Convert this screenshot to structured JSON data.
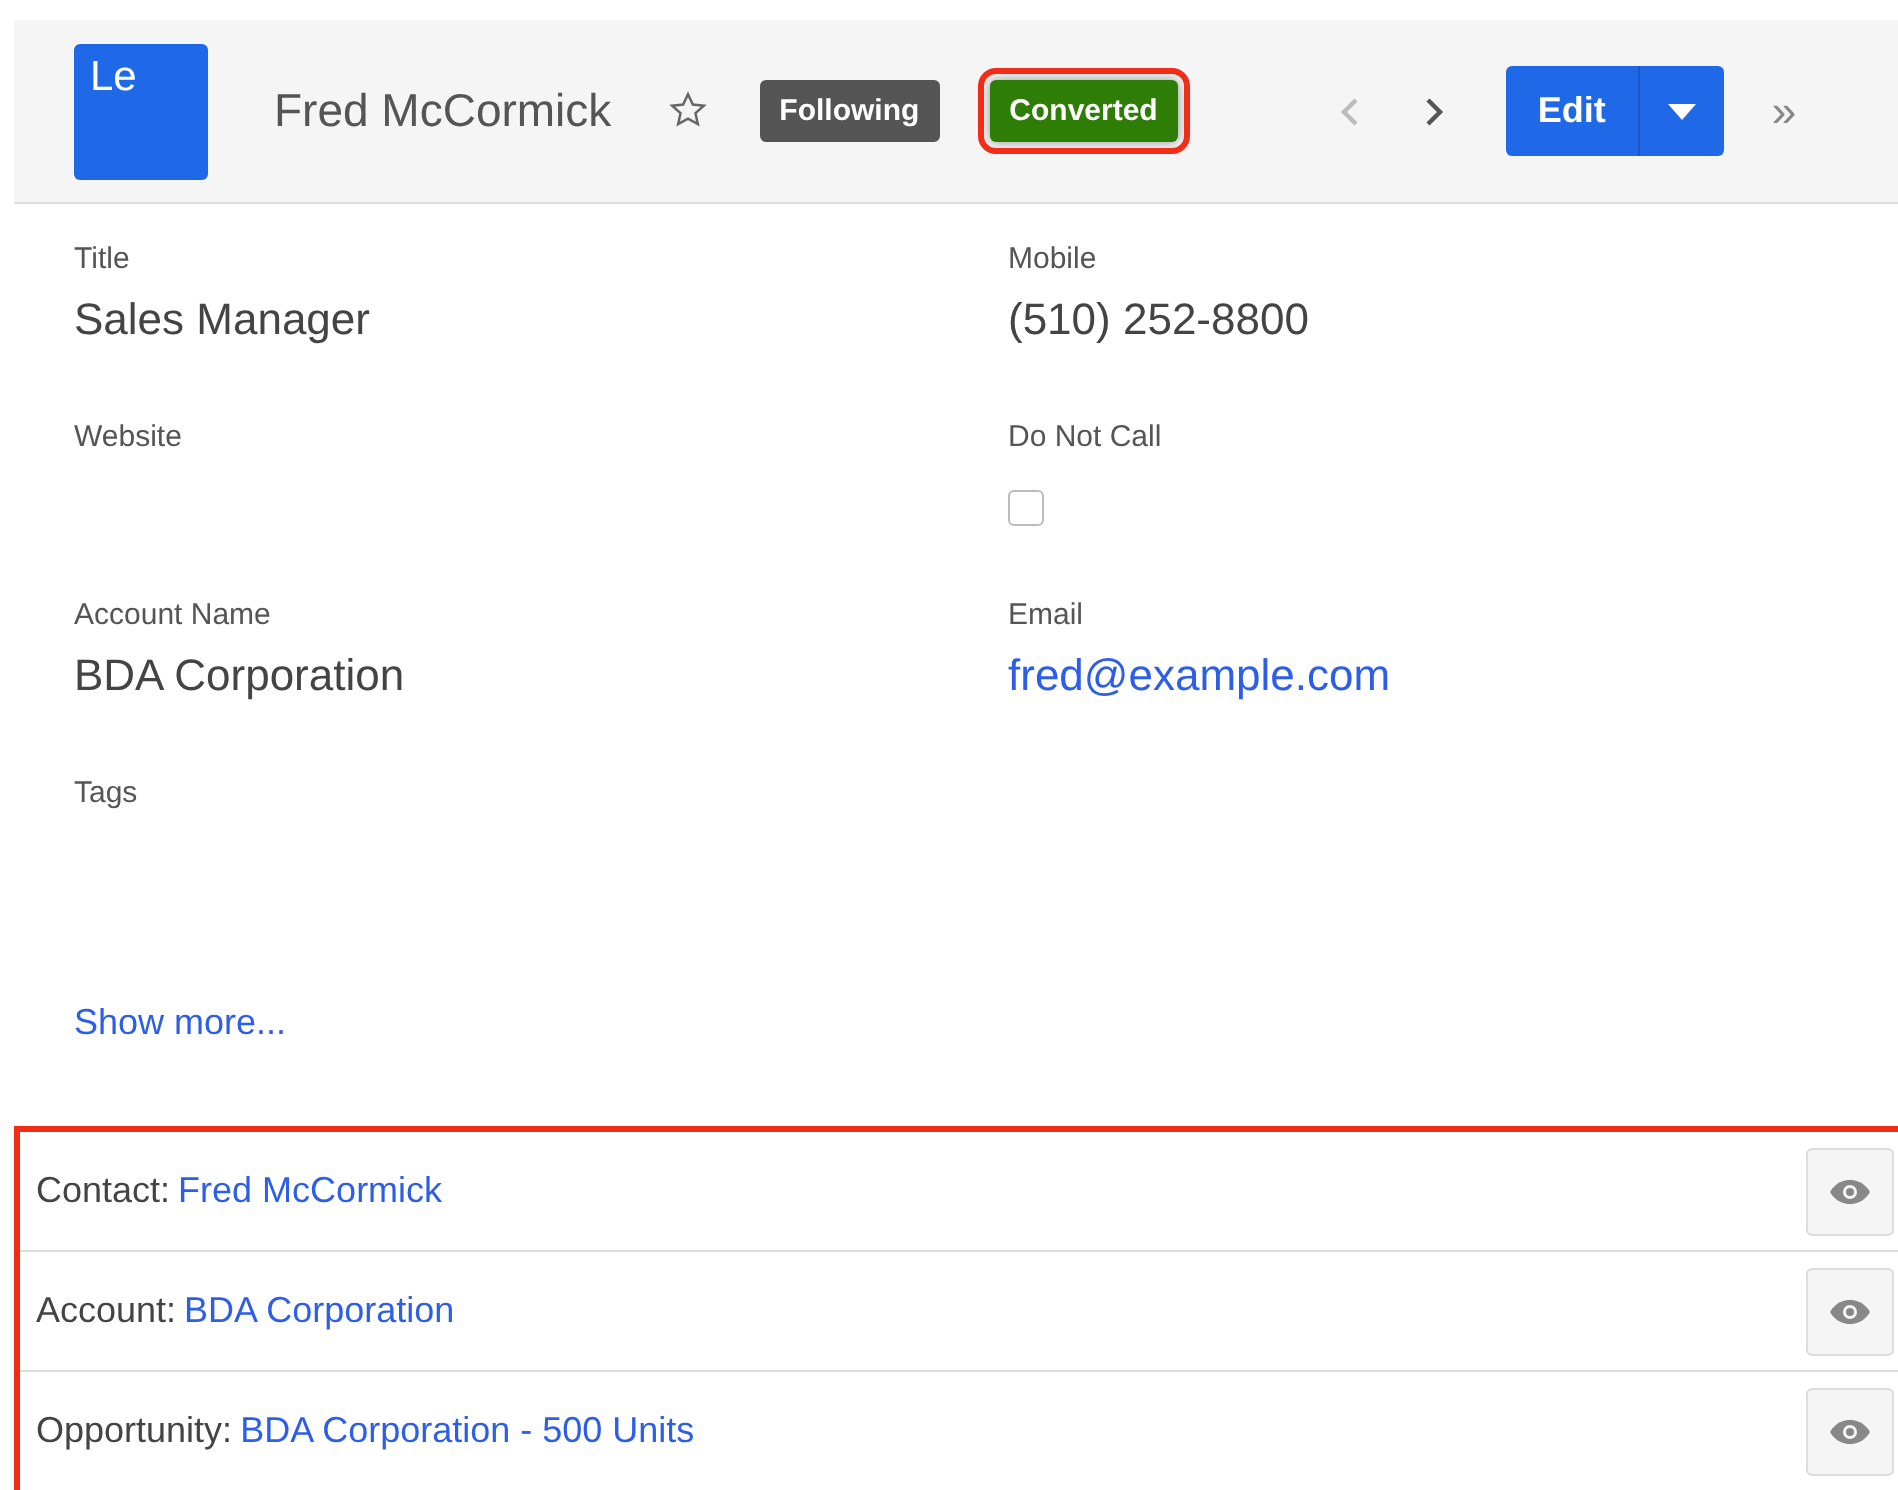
{
  "header": {
    "avatar": "Le",
    "name": "Fred McCormick",
    "favorite": false,
    "badges": [
      {
        "label": "Following",
        "kind": "following",
        "highlighted": false
      },
      {
        "label": "Converted",
        "kind": "converted",
        "highlighted": true
      }
    ],
    "prev_disabled": true,
    "next_disabled": false,
    "edit_button": "Edit",
    "more": "»"
  },
  "fields": [
    {
      "label": "Title",
      "kind": "text",
      "value": "Sales Manager"
    },
    {
      "label": "Mobile",
      "kind": "text",
      "value": "(510) 252-8800"
    },
    {
      "label": "Website",
      "kind": "empty"
    },
    {
      "label": "Do Not Call",
      "kind": "checkbox",
      "checked": false
    },
    {
      "label": "Account Name",
      "kind": "text",
      "value": "BDA Corporation"
    },
    {
      "label": "Email",
      "kind": "link",
      "value": "fred@example.com"
    },
    {
      "label": "Tags",
      "kind": "empty"
    }
  ],
  "show_more": "Show more...",
  "related": {
    "highlighted": true,
    "rows": [
      {
        "label": "Contact:",
        "link": "Fred McCormick"
      },
      {
        "label": "Account:",
        "link": "BDA Corporation"
      },
      {
        "label": "Opportunity:",
        "link": "BDA Corporation - 500 Units"
      }
    ]
  }
}
